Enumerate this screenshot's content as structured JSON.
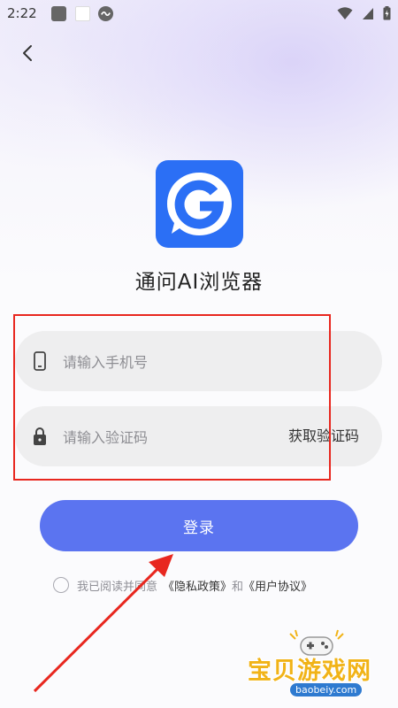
{
  "status_bar": {
    "time": "2:22"
  },
  "app": {
    "title": "通问AI浏览器"
  },
  "form": {
    "phone_placeholder": "请输入手机号",
    "code_placeholder": "请输入验证码",
    "get_code_label": "获取验证码",
    "login_label": "登录"
  },
  "agreement": {
    "prefix": "我已阅读并同意",
    "privacy": "《隐私政策》",
    "and": "和",
    "terms": "《用户协议》"
  },
  "colors": {
    "accent": "#5b74f0",
    "logo_bg": "#2b6ff5",
    "annotation": "#e8271f",
    "field_bg": "#eeeeef"
  },
  "icons": [
    "back-arrow-icon",
    "phone-icon",
    "lock-icon",
    "wifi-icon",
    "signal-icon",
    "battery-icon",
    "screen-capture-icon"
  ],
  "watermark": {
    "site_cn": "宝贝游戏网",
    "site_url": "baobeiy.com"
  }
}
